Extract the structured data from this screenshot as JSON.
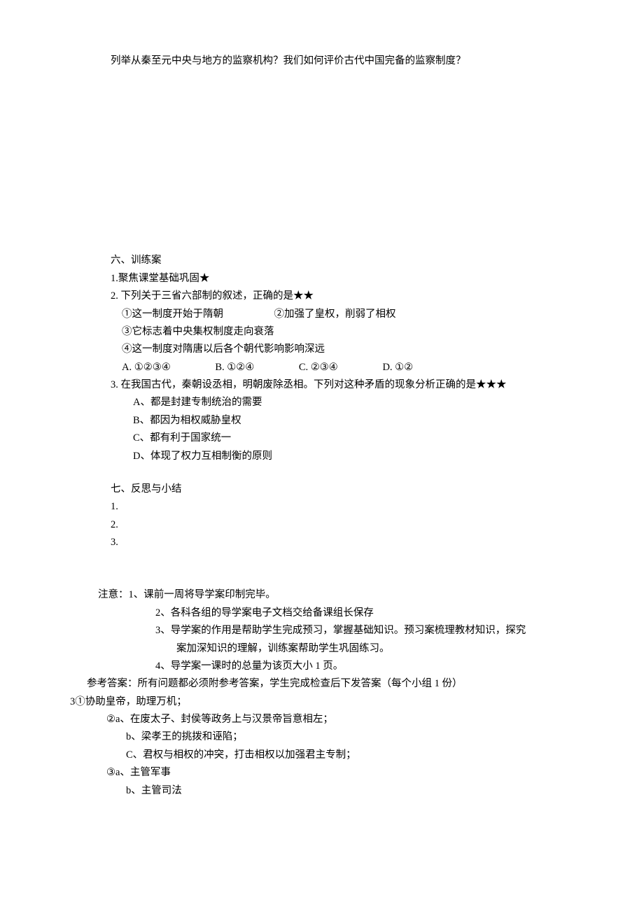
{
  "topQuestion": "列举从秦至元中央与地方的监察机构？我们如何评价古代中国完备的监察制度？",
  "section6": {
    "title": "六、训练案",
    "q1": "1.聚焦课堂基础巩固★",
    "q2": {
      "stem": "2.  下列关于三省六部制的叙述，正确的是★★",
      "opt1a": "①这一制度开始于隋朝",
      "opt1b": "②加强了皇权，削弱了相权",
      "opt2": "③它标志着中央集权制度走向衰落",
      "opt3": "④这一制度对隋唐以后各个朝代影响影响深远",
      "choiceA": "A.  ①②③④",
      "choiceB": "B.  ①②④",
      "choiceC": "C.  ②③④",
      "choiceD": "D.  ①②"
    },
    "q3": {
      "stem": "3.  在我国古代，秦朝设丞相，明朝废除丞相。下列对这种矛盾的现象分析正确的是★★★",
      "optA": "A、都是封建专制统治的需要",
      "optB": "B、都因为相权威胁皇权",
      "optC": "C、都有利于国家统一",
      "optD": "D、体现了权力互相制衡的原则"
    }
  },
  "section7": {
    "title": "七、反思与小结",
    "item1": "1.",
    "item2": "2.",
    "item3": "3."
  },
  "notes": {
    "line1": "注意：1、课前一周将导学案印制完毕。",
    "line2": "2、各科各组的导学案电子文档交给备课组长保存",
    "line3a": "3、导学案的作用是帮助学生完成预习，掌握基础知识。预习案梳理教材知识，探究",
    "line3b": "案加深知识的理解，训练案帮助学生巩固练习。",
    "line4": "4、导学案一课时的总量为该页大小 1 页。"
  },
  "answers": {
    "header": "参考答案：所有问题都必须附参考答案，学生完成检查后下发答案（每个小组 1 份）",
    "a3_1": "3①协助皇帝，助理万机；",
    "a3_2a": "②a、在废太子、封侯等政务上与汉景帝旨意相左；",
    "a3_2b": "b、梁孝王的挑拨和诬陷；",
    "a3_2c": "C、君权与相权的冲突，打击相权以加强君主专制；",
    "a3_3a": "③a、主管军事",
    "a3_3b": "b、主管司法"
  }
}
